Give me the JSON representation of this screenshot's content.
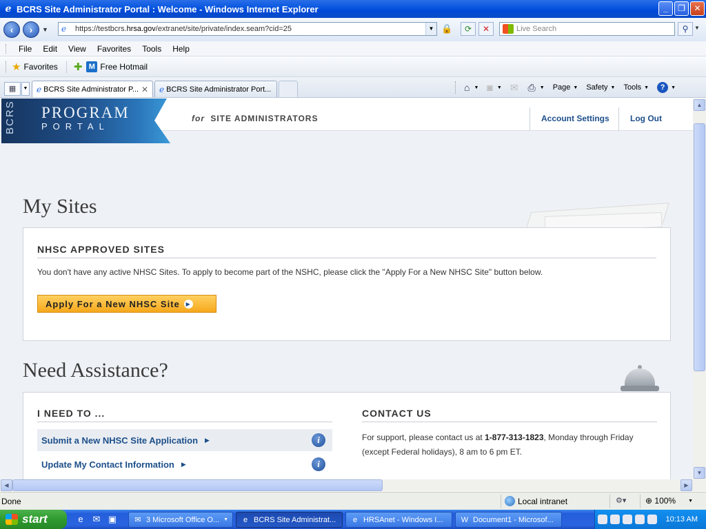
{
  "window": {
    "title": "BCRS Site Administrator Portal : Welcome - Windows Internet Explorer",
    "minimize": "_",
    "maximize": "❐",
    "close": "✕"
  },
  "address": {
    "url_prefix": "https://testbcrs.",
    "url_domain": "hrsa.gov",
    "url_path": "/extranet/site/private/index.seam?cid=25",
    "search_placeholder": "Live Search"
  },
  "menu": [
    "File",
    "Edit",
    "View",
    "Favorites",
    "Tools",
    "Help"
  ],
  "favorites": {
    "label": "Favorites",
    "hotmail": "Free Hotmail"
  },
  "tabs": [
    {
      "label": "BCRS Site Administrator P...",
      "active": true
    },
    {
      "label": "BCRS Site Administrator Port...",
      "active": false
    }
  ],
  "commands": {
    "page": "Page",
    "safety": "Safety",
    "tools": "Tools"
  },
  "portal": {
    "logo_side": "BCRS",
    "logo_program": "PROGRAM",
    "logo_portal": "PORTAL",
    "tagline_for": "for",
    "tagline": "SITE ADMINISTRATORS",
    "account_settings": "Account Settings",
    "log_out": "Log Out"
  },
  "my_sites": {
    "heading": "My Sites",
    "card_title": "NHSC APPROVED SITES",
    "message": "You don't have any active NHSC Sites. To apply to become part of the NSHC, please click the \"Apply For a New NHSC Site\" button below.",
    "apply_button": "Apply For a New NHSC Site"
  },
  "assistance": {
    "heading": "Need Assistance?",
    "need_to_title": "I NEED TO ...",
    "items": [
      {
        "label": "Submit a New NHSC Site Application"
      },
      {
        "label": "Update My Contact Information"
      }
    ],
    "contact_title": "CONTACT US",
    "contact_pre": "For support, please contact us at ",
    "contact_phone": "1-877-313-1823",
    "contact_post": ", Monday through Friday (except Federal holidays), 8 am to 6 pm ET."
  },
  "status": {
    "text": "Done",
    "zone": "Local intranet",
    "zoom": "100%"
  },
  "taskbar": {
    "start": "start",
    "tasks": [
      {
        "label": "3 Microsoft Office O...",
        "active": false
      },
      {
        "label": "BCRS Site Administrat...",
        "active": true
      },
      {
        "label": "HRSAnet - Windows I...",
        "active": false
      },
      {
        "label": "Document1 - Microsof...",
        "active": false
      }
    ],
    "clock": "10:13 AM"
  },
  "colors": {
    "link_blue": "#1d4f8a",
    "apply_orange": "#f6a81c",
    "xp_blue": "#245edb",
    "start_green": "#2f9a2f"
  }
}
